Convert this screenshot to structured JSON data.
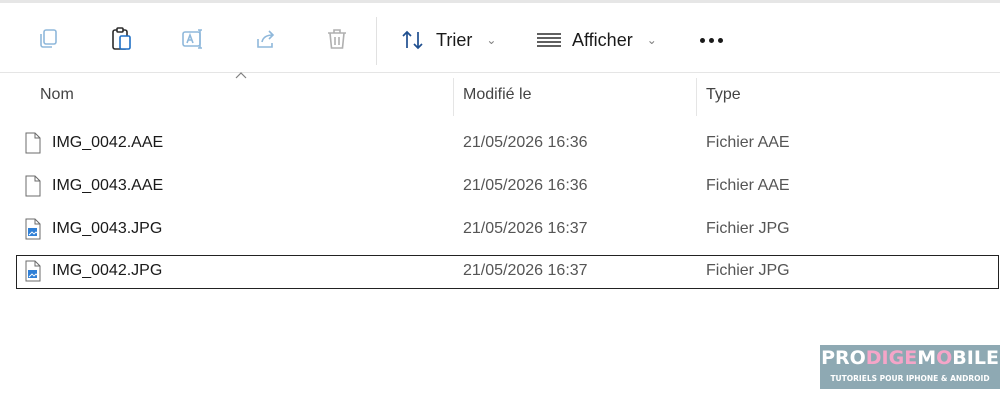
{
  "toolbar": {
    "icons": [
      "copy-icon",
      "paste-icon",
      "rename-icon",
      "share-icon",
      "delete-icon"
    ],
    "sort_label": "Trier",
    "view_label": "Afficher"
  },
  "columns": {
    "name": "Nom",
    "modified": "Modifié le",
    "type": "Type"
  },
  "files": [
    {
      "name": "IMG_0042.AAE",
      "modified": "21/05/2026 16:36",
      "type": "Fichier AAE",
      "icon": "document-icon"
    },
    {
      "name": "IMG_0043.AAE",
      "modified": "21/05/2026 16:36",
      "type": "Fichier AAE",
      "icon": "document-icon"
    },
    {
      "name": "IMG_0043.JPG",
      "modified": "21/05/2026 16:37",
      "type": "Fichier JPG",
      "icon": "image-file-icon"
    },
    {
      "name": "IMG_0042.JPG",
      "modified": "21/05/2026 16:37",
      "type": "Fichier JPG",
      "icon": "image-file-icon",
      "selected": true
    }
  ],
  "watermark": {
    "brand_a": "PRO",
    "brand_b": "DIGE",
    "brand_c": "M",
    "brand_d": "O",
    "brand_e": "BILE",
    "tagline": "TUTORIELS POUR IPHONE & ANDROID"
  }
}
